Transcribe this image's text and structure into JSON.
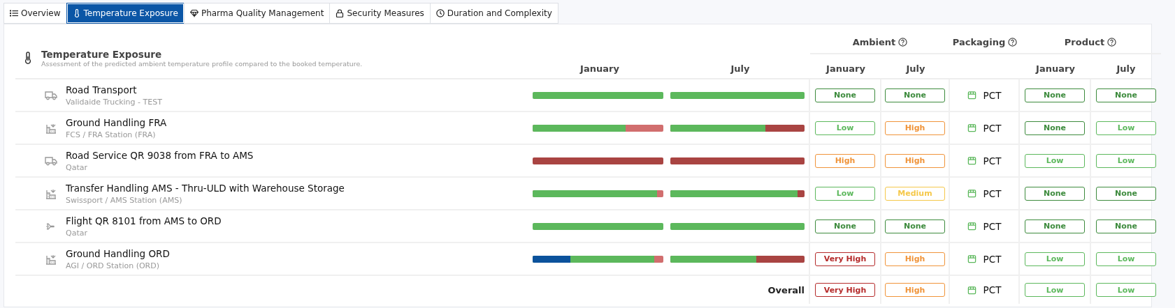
{
  "tabs": [
    {
      "label": "Overview",
      "kind": "list",
      "selected": false
    },
    {
      "label": "Temperature Exposure",
      "kind": "thermometer",
      "selected": true
    },
    {
      "label": "Pharma Quality Management",
      "kind": "diamond",
      "selected": false
    },
    {
      "label": "Security Measures",
      "kind": "lock",
      "selected": false
    },
    {
      "label": "Duration and Complexity",
      "kind": "clock",
      "selected": false
    }
  ],
  "section": {
    "title": "Temperature Exposure",
    "subtitle": "Assessment of the predicted ambient temperature profile compared to the booked temperature."
  },
  "column_groups": [
    {
      "label": "Ambient"
    },
    {
      "label": "Packaging"
    },
    {
      "label": "Product"
    }
  ],
  "bar_columns": [
    "January",
    "July"
  ],
  "ambient_columns": [
    "January",
    "July"
  ],
  "product_columns": [
    "January",
    "July"
  ],
  "rows": [
    {
      "kind": "truck",
      "title": "Road Transport",
      "subtitle": "Validaide Trucking - TEST",
      "bars": [
        [
          {
            "color": "#5cb85c",
            "level": 1
          }
        ],
        [
          {
            "color": "#5cb85c",
            "level": 1
          }
        ]
      ],
      "ambient": [
        {
          "text": "None",
          "color": "#3d8b3d"
        },
        {
          "text": "None",
          "color": "#3d8b3d"
        }
      ],
      "packaging": "PCT",
      "product": [
        {
          "text": "None",
          "color": "#3d8b3d"
        },
        {
          "text": "None",
          "color": "#3d8b3d"
        }
      ]
    },
    {
      "kind": "handling",
      "title": "Ground Handling FRA",
      "subtitle": "FCS / FRA Station (FRA)",
      "bars": [
        [
          {
            "color": "#5cb85c",
            "level": 0.71
          },
          {
            "color": "#d16e6e",
            "level": 1
          }
        ],
        [
          {
            "color": "#5cb85c",
            "level": 0.71
          },
          {
            "color": "#a94442",
            "level": 1
          }
        ]
      ],
      "ambient": [
        {
          "text": "Low",
          "color": "#5cb85c"
        },
        {
          "text": "High",
          "color": "#f0943a"
        }
      ],
      "packaging": "PCT",
      "product": [
        {
          "text": "None",
          "color": "#3d8b3d"
        },
        {
          "text": "Low",
          "color": "#5cb85c"
        }
      ]
    },
    {
      "kind": "truck",
      "title": "Road Service QR 9038 from FRA to AMS",
      "subtitle": "Qatar",
      "bars": [
        [
          {
            "color": "#a94442",
            "level": 1
          }
        ],
        [
          {
            "color": "#a94442",
            "level": 1
          }
        ]
      ],
      "ambient": [
        {
          "text": "High",
          "color": "#f0943a"
        },
        {
          "text": "High",
          "color": "#f0943a"
        }
      ],
      "packaging": "PCT",
      "product": [
        {
          "text": "Low",
          "color": "#5cb85c"
        },
        {
          "text": "Low",
          "color": "#5cb85c"
        }
      ]
    },
    {
      "kind": "handling",
      "title": "Transfer Handling AMS - Thru-ULD with Warehouse Storage",
      "subtitle": "Swissport / AMS Station (AMS)",
      "bars": [
        [
          {
            "color": "#5cb85c",
            "level": 0.95
          },
          {
            "color": "#d16e6e",
            "level": 1
          }
        ],
        [
          {
            "color": "#5cb85c",
            "level": 0.95
          },
          {
            "color": "#a94442",
            "level": 1
          }
        ]
      ],
      "ambient": [
        {
          "text": "Low",
          "color": "#5cb85c"
        },
        {
          "text": "Medium",
          "color": "#f5c84a"
        }
      ],
      "packaging": "PCT",
      "product": [
        {
          "text": "None",
          "color": "#3d8b3d"
        },
        {
          "text": "None",
          "color": "#3d8b3d"
        }
      ]
    },
    {
      "kind": "flight",
      "title": "Flight QR 8101 from AMS to ORD",
      "subtitle": "Qatar",
      "bars": [
        [
          {
            "color": "#5cb85c",
            "level": 1
          }
        ],
        [
          {
            "color": "#5cb85c",
            "level": 1
          }
        ]
      ],
      "ambient": [
        {
          "text": "None",
          "color": "#3d8b3d"
        },
        {
          "text": "None",
          "color": "#3d8b3d"
        }
      ],
      "packaging": "PCT",
      "product": [
        {
          "text": "None",
          "color": "#3d8b3d"
        },
        {
          "text": "None",
          "color": "#3d8b3d"
        }
      ]
    },
    {
      "kind": "handling",
      "title": "Ground Handling ORD",
      "subtitle": "AGI / ORD Station (ORD)",
      "bars": [
        [
          {
            "color": "#0b529c",
            "level": 0.29
          },
          {
            "color": "#5cb85c",
            "level": 0.93
          },
          {
            "color": "#d16e6e",
            "level": 1
          }
        ],
        [
          {
            "color": "#5cb85c",
            "level": 0.64
          },
          {
            "color": "#a94442",
            "level": 1
          }
        ]
      ],
      "ambient": [
        {
          "text": "Very High",
          "color": "#b52b2b"
        },
        {
          "text": "High",
          "color": "#f0943a"
        }
      ],
      "packaging": "PCT",
      "product": [
        {
          "text": "Low",
          "color": "#5cb85c"
        },
        {
          "text": "Low",
          "color": "#5cb85c"
        }
      ]
    }
  ],
  "overall": {
    "label": "Overall",
    "ambient": [
      {
        "text": "Very High",
        "color": "#b52b2b"
      },
      {
        "text": "High",
        "color": "#f0943a"
      }
    ],
    "packaging": "PCT",
    "product": [
      {
        "text": "Low",
        "color": "#5cb85c"
      },
      {
        "text": "Low",
        "color": "#5cb85c"
      }
    ]
  }
}
